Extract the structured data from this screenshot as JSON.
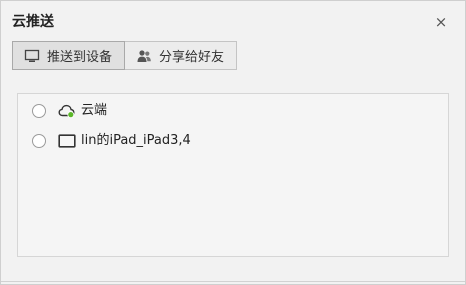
{
  "dialog": {
    "title": "云推送",
    "close_glyph": "×",
    "close_icon": "close-icon"
  },
  "tabs": [
    {
      "label": "推送到设备",
      "icon": "monitor-icon",
      "active": true
    },
    {
      "label": "分享给好友",
      "icon": "users-icon",
      "active": false
    }
  ],
  "devices": [
    {
      "label": "云端",
      "icon": "cloud-icon",
      "selected": false
    },
    {
      "label": "lin的iPad_iPad3,4",
      "icon": "tablet-icon",
      "selected": false
    }
  ],
  "colors": {
    "online_dot": "#5cb82a",
    "border": "#c4c4c4"
  }
}
